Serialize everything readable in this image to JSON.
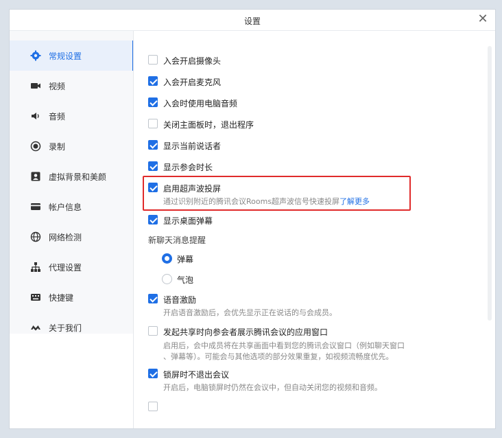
{
  "window": {
    "title": "设置"
  },
  "sidebar": {
    "items": [
      {
        "label": "常规设置",
        "icon": "gear-icon",
        "active": true
      },
      {
        "label": "视频",
        "icon": "video-camera-icon"
      },
      {
        "label": "音频",
        "icon": "speaker-icon"
      },
      {
        "label": "录制",
        "icon": "record-icon"
      },
      {
        "label": "虚拟背景和美颜",
        "icon": "portrait-icon"
      },
      {
        "label": "帐户信息",
        "icon": "card-icon"
      },
      {
        "label": "网络检测",
        "icon": "globe-icon"
      },
      {
        "label": "代理设置",
        "icon": "network-icon"
      },
      {
        "label": "快捷键",
        "icon": "keyboard-icon"
      },
      {
        "label": "关于我们",
        "icon": "logo-icon"
      }
    ]
  },
  "options": [
    {
      "label": "入会开启摄像头",
      "checked": false
    },
    {
      "label": "入会开启麦克风",
      "checked": true
    },
    {
      "label": "入会时使用电脑音频",
      "checked": true
    },
    {
      "label": "关闭主面板时，退出程序",
      "checked": false
    },
    {
      "label": "显示当前说话者",
      "checked": true
    },
    {
      "label": "显示参会时长",
      "checked": true
    },
    {
      "label": "启用超声波投屏",
      "checked": true,
      "desc": "通过识别附近的腾讯会议Rooms超声波信号快速投屏",
      "link": "了解更多"
    },
    {
      "label": "显示桌面弹幕",
      "checked": true
    }
  ],
  "chat_notice": {
    "title": "新聊天消息提醒",
    "radios": [
      {
        "label": "弹幕",
        "selected": true
      },
      {
        "label": "气泡",
        "selected": false
      }
    ]
  },
  "more_options": [
    {
      "label": "语音激励",
      "checked": true,
      "desc": "开启语音激励后，会优先显示正在说话的与会成员。"
    },
    {
      "label": "发起共享时向参会者展示腾讯会议的应用窗口",
      "checked": false,
      "desc": "启用后，会中成员将在共享画面中看到您的腾讯会议窗口（例如聊天窗口",
      "desc2": "、弹幕等）。可能会与其他选项的部分效果重复，如视频流畅度优先。"
    },
    {
      "label": "锁屏时不退出会议",
      "checked": true,
      "desc": "开启后，电脑锁屏时仍然在会议中，但自动关闭您的视频和音频。"
    }
  ]
}
